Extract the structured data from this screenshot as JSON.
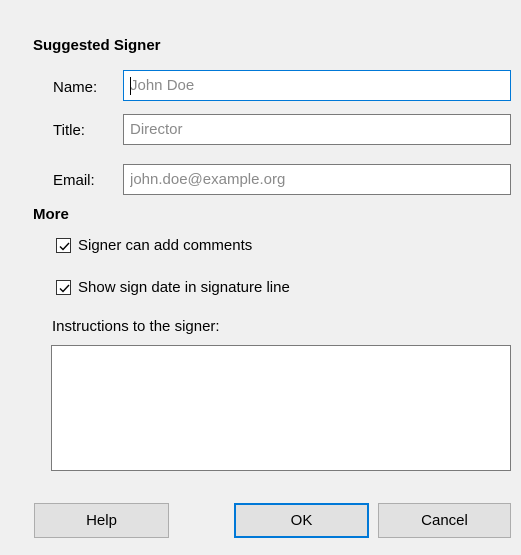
{
  "suggested_signer": {
    "heading": "Suggested Signer",
    "name_label": "Name:",
    "name_placeholder": "John Doe",
    "title_label": "Title:",
    "title_placeholder": "Director",
    "email_label": "Email:",
    "email_placeholder": "john.doe@example.org"
  },
  "more": {
    "heading": "More",
    "add_comments_label": "Signer can add comments",
    "add_comments_checked": true,
    "show_date_label": "Show sign date in signature line",
    "show_date_checked": true,
    "instructions_label": "Instructions to the signer:",
    "instructions_value": ""
  },
  "buttons": {
    "help": "Help",
    "ok": "OK",
    "cancel": "Cancel"
  },
  "colors": {
    "background": "#f0f0f0",
    "focus_border": "#0078d7"
  }
}
